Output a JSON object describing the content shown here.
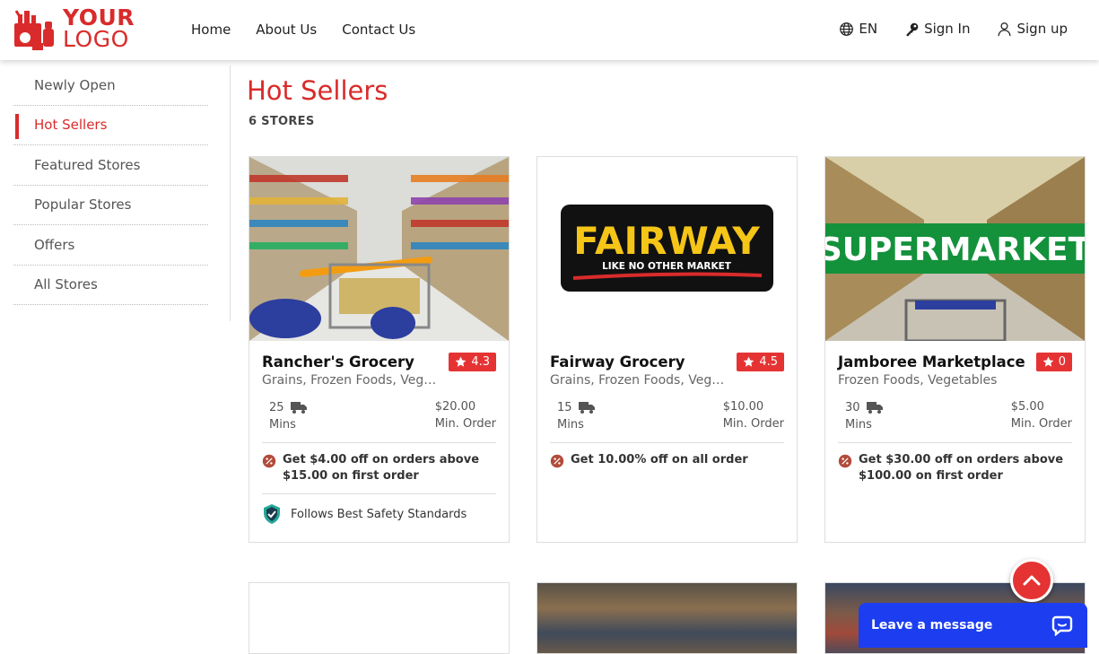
{
  "header": {
    "logo_line1": "YOUR",
    "logo_line2": "LOGO",
    "nav": [
      "Home",
      "About Us",
      "Contact Us"
    ],
    "language": "EN",
    "sign_in": "Sign In",
    "sign_up": "Sign up"
  },
  "sidebar": {
    "items": [
      {
        "label": "Newly Open",
        "active": false
      },
      {
        "label": "Hot Sellers",
        "active": true
      },
      {
        "label": "Featured Stores",
        "active": false
      },
      {
        "label": "Popular Stores",
        "active": false
      },
      {
        "label": "Offers",
        "active": false
      },
      {
        "label": "All Stores",
        "active": false
      }
    ]
  },
  "main": {
    "title": "Hot Sellers",
    "count": "6 STORES",
    "stores": [
      {
        "name": "Rancher's Grocery",
        "categories": "Grains, Frozen Foods, Vegetables",
        "rating": "4.3",
        "time": "25",
        "time_unit": "Mins",
        "min_order": "$20.00",
        "min_order_label": "Min. Order",
        "offer": "Get $4.00 off on orders above $15.00 on first order",
        "safety": "Follows Best Safety Standards",
        "image": "grocery-aisle-cart"
      },
      {
        "name": "Fairway Grocery",
        "categories": "Grains, Frozen Foods, Vegetables",
        "rating": "4.5",
        "time": "15",
        "time_unit": "Mins",
        "min_order": "$10.00",
        "min_order_label": "Min. Order",
        "offer": "Get 10.00% off on all order",
        "logo_text": "FAIRWAY",
        "logo_tagline": "LIKE NO OTHER MARKET",
        "image": "fairway-logo"
      },
      {
        "name": "Jamboree Marketplace",
        "categories": "Frozen Foods, Vegetables",
        "rating": "0",
        "time": "30",
        "time_unit": "Mins",
        "min_order": "$5.00",
        "min_order_label": "Min. Order",
        "offer": "Get $30.00 off on orders above $100.00 on first order",
        "banner": "SUPERMARKET",
        "image": "supermarket-banner"
      }
    ]
  },
  "chat": {
    "label": "Leave a message"
  },
  "colors": {
    "accent": "#d92b2b",
    "chat": "#1c3ef0"
  }
}
